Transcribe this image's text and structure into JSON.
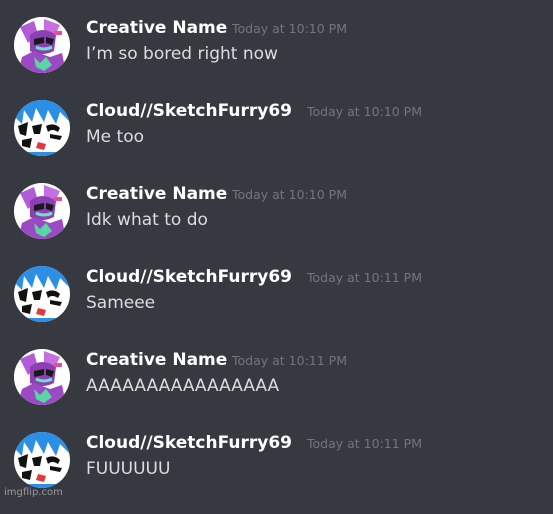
{
  "messages": [
    {
      "username": "Creative Name",
      "timestamp": "Today at 10:10 PM",
      "content": "I’m so bored right now",
      "avatar_icon": "purple-character-avatar-icon"
    },
    {
      "username": "Cloud//SketchFurry69",
      "timestamp": "Today at 10:10 PM",
      "content": "Me too",
      "avatar_icon": "blue-hair-character-avatar-icon"
    },
    {
      "username": "Creative Name",
      "timestamp": "Today at 10:10 PM",
      "content": "Idk what to do",
      "avatar_icon": "purple-character-avatar-icon"
    },
    {
      "username": "Cloud//SketchFurry69",
      "timestamp": "Today at 10:11 PM",
      "content": "Sameee",
      "avatar_icon": "blue-hair-character-avatar-icon"
    },
    {
      "username": "Creative Name",
      "timestamp": "Today at 10:11 PM",
      "content": "AAAAAAAAAAAAAAAA",
      "avatar_icon": "purple-character-avatar-icon"
    },
    {
      "username": "Cloud//SketchFurry69",
      "timestamp": "Today at 10:11 PM",
      "content": "FUUUUUU",
      "avatar_icon": "blue-hair-character-avatar-icon"
    }
  ],
  "watermark": "imgflip.com",
  "colors": {
    "background": "#36393f",
    "username": "#ffffff",
    "timestamp": "#72767d",
    "message_text": "#dcddde"
  }
}
